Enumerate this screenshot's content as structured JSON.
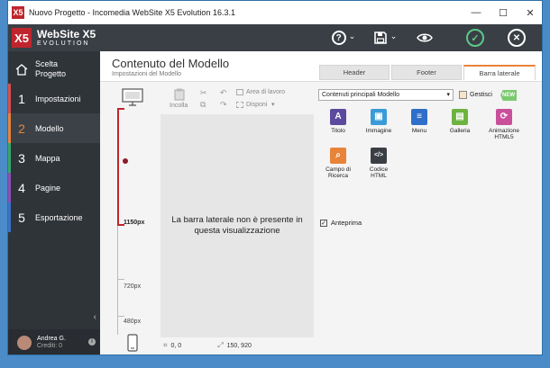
{
  "window": {
    "title": "Nuovo Progetto - Incomedia WebSite X5 Evolution 16.3.1",
    "app_icon": "X5",
    "controls": {
      "minimize": "—",
      "maximize": "☐",
      "close": "✕"
    }
  },
  "header": {
    "logo_mark": "X5",
    "logo_line1": "WebSite X5",
    "logo_line2": "EVOLUTION",
    "help_icon": "?",
    "save_icon": "💾",
    "preview_icon": "👁",
    "confirm_icon": "✓",
    "close_icon": "✕",
    "chevron": "⌄"
  },
  "sidebar": {
    "items": [
      {
        "num": "⌂",
        "label": "Scelta\nProgetto",
        "color": "#2f3439"
      },
      {
        "num": "1",
        "label": "Impostazioni",
        "color": "#d94e4e"
      },
      {
        "num": "2",
        "label": "Modello",
        "color": "#e8833a"
      },
      {
        "num": "3",
        "label": "Mappa",
        "color": "#3aa66b"
      },
      {
        "num": "4",
        "label": "Pagine",
        "color": "#8e4fb4"
      },
      {
        "num": "5",
        "label": "Esportazione",
        "color": "#3b73c4"
      }
    ],
    "collapse": "‹",
    "user": {
      "name": "Andrea G.",
      "credits": "Crediti: 0",
      "info": "i"
    }
  },
  "page": {
    "title": "Contenuto del Modello",
    "subtitle": "Impostazioni del Modello",
    "tabs": [
      "Header",
      "Footer",
      "Barra laterale"
    ],
    "active_tab": "Barra laterale"
  },
  "ruler": {
    "labels": [
      "1150px",
      "720px",
      "480px"
    ]
  },
  "toolbar": {
    "paste": "Incolla",
    "workspace": "Area di lavoro",
    "arrange": "Disponi"
  },
  "canvas": {
    "message": "La barra laterale non è presente in questa visualizzazione"
  },
  "coords": {
    "position": "0, 0",
    "size": "150, 920"
  },
  "objects": {
    "select_value": "Contenuti principali Modello",
    "manage": "Gestisci",
    "new_badge": "NEW",
    "items": [
      {
        "label": "Titolo",
        "icon": "A",
        "color": "#5b4a9e"
      },
      {
        "label": "Immagine",
        "icon": "▣",
        "color": "#3a9bd8"
      },
      {
        "label": "Menu",
        "icon": "≡",
        "color": "#2f6fc9"
      },
      {
        "label": "Galleria",
        "icon": "▤",
        "color": "#6db33f"
      },
      {
        "label": "Animazione HTML5",
        "icon": "⟳",
        "color": "#c94f9b"
      },
      {
        "label": "Campo di Ricerca",
        "icon": "⌕",
        "color": "#e8833a"
      },
      {
        "label": "Codice HTML",
        "icon": "</>",
        "color": "#3a3f45"
      }
    ],
    "preview_label": "Anteprima",
    "preview_checked": "✓"
  }
}
